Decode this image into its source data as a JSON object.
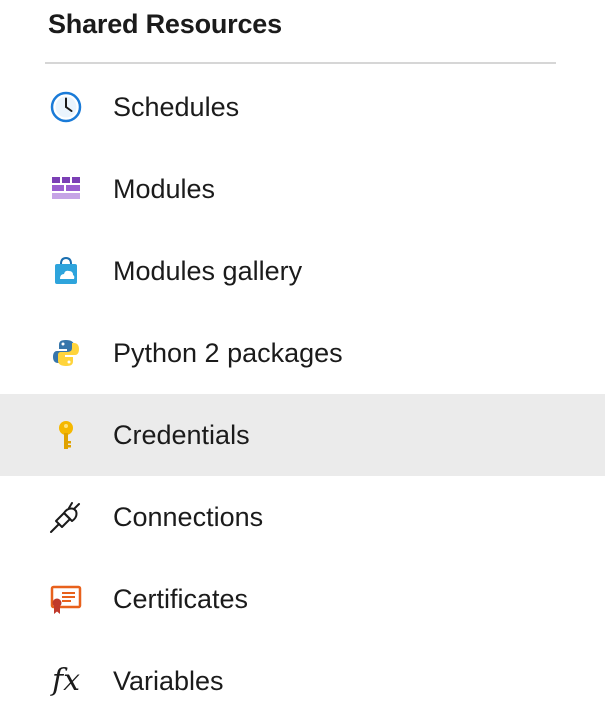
{
  "section": {
    "title": "Shared Resources"
  },
  "nav": {
    "items": [
      {
        "label": "Schedules",
        "icon": "clock-icon",
        "selected": false
      },
      {
        "label": "Modules",
        "icon": "modules-icon",
        "selected": false
      },
      {
        "label": "Modules gallery",
        "icon": "gallery-bag-icon",
        "selected": false
      },
      {
        "label": "Python 2 packages",
        "icon": "python-icon",
        "selected": false
      },
      {
        "label": "Credentials",
        "icon": "key-icon",
        "selected": true
      },
      {
        "label": "Connections",
        "icon": "plug-icon",
        "selected": false
      },
      {
        "label": "Certificates",
        "icon": "certificate-icon",
        "selected": false
      },
      {
        "label": "Variables",
        "icon": "fx-icon",
        "selected": false,
        "glyph": "fx"
      }
    ]
  },
  "colors": {
    "selected_background": "#ebebeb",
    "divider": "#d6d6d6",
    "clock_blue": "#1a7bd8",
    "modules_purple": "#7b3fb5",
    "gallery_blue": "#2ea4dc",
    "python_blue": "#3776ab",
    "python_yellow": "#ffd43b",
    "key_gold": "#f5b800",
    "certificate_orange": "#e8611c",
    "certificate_red": "#c0392b"
  }
}
